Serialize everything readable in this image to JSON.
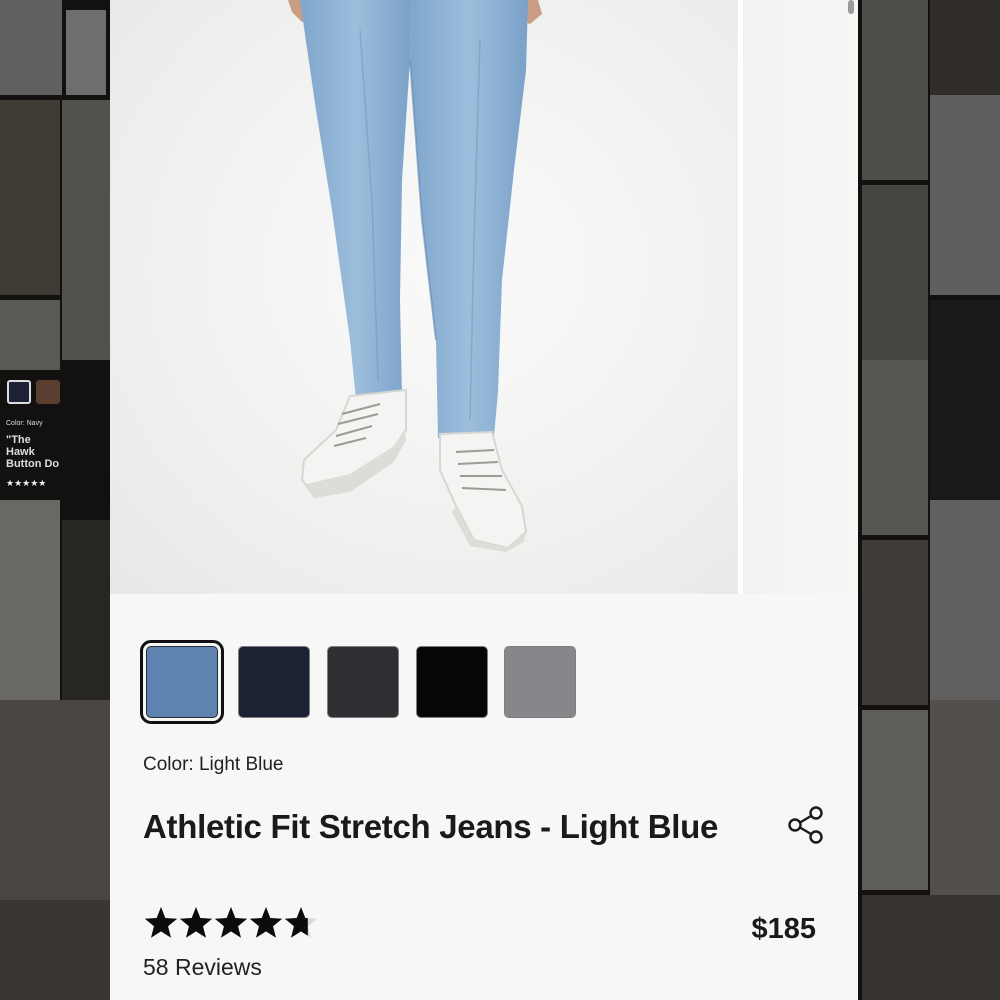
{
  "background_page": {
    "snippet_color_label": "Color: Navy",
    "snippet_product_name": "\"The Hawk Button Do",
    "snippet_stars": "★★★★★"
  },
  "product": {
    "image_alt": "Model wearing light blue athletic fit jeans with white sneakers",
    "color_label": "Color: Light Blue",
    "title": "Athletic Fit Stretch Jeans - Light Blue",
    "price": "$185",
    "rating": 4.7,
    "rating_max": 5,
    "reviews": "58 Reviews",
    "swatches": [
      {
        "name": "Light Blue",
        "color": "#5e83b1",
        "selected": true
      },
      {
        "name": "Navy",
        "color": "#1c2233",
        "selected": false
      },
      {
        "name": "Charcoal",
        "color": "#2e2e33",
        "selected": false
      },
      {
        "name": "Black",
        "color": "#060606",
        "selected": false
      },
      {
        "name": "Grey",
        "color": "#87878b",
        "selected": false
      }
    ]
  },
  "icons": {
    "share": "share-icon",
    "star": "star-icon"
  },
  "colors": {
    "jeans": "#8fb3d4",
    "jeans_shadow": "#6f94b9",
    "panel": "#f7f7f7",
    "text": "#1a1a1a"
  }
}
